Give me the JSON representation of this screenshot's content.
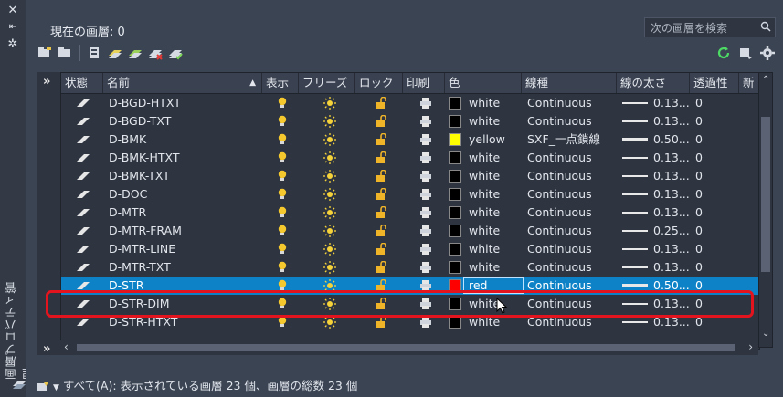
{
  "app": {
    "side_title": "画層プロパティ管理",
    "current_layer_label": "現在の画層: 0",
    "search_placeholder": "次の画層を検索",
    "status_text": "すべて(A): 表示されている画層 23 個、画層の総数 23 個"
  },
  "columns": [
    "状態",
    "名前",
    "表示",
    "フリーズ",
    "ロック",
    "印刷",
    "色",
    "線種",
    "線の太さ",
    "透過性",
    "新"
  ],
  "rows": [
    {
      "name": "D-BGD-HTXT",
      "color": "white",
      "color_hex": "#000000",
      "linetype": "Continuous",
      "lineweight": "0.13...",
      "transparency": "0",
      "thick": false
    },
    {
      "name": "D-BGD-TXT",
      "color": "white",
      "color_hex": "#000000",
      "linetype": "Continuous",
      "lineweight": "0.13...",
      "transparency": "0",
      "thick": false
    },
    {
      "name": "D-BMK",
      "color": "yellow",
      "color_hex": "#ffff00",
      "linetype": "SXF_一点鎖線",
      "lineweight": "0.50...",
      "transparency": "0",
      "thick": true
    },
    {
      "name": "D-BMK-HTXT",
      "color": "white",
      "color_hex": "#000000",
      "linetype": "Continuous",
      "lineweight": "0.13...",
      "transparency": "0",
      "thick": false
    },
    {
      "name": "D-BMK-TXT",
      "color": "white",
      "color_hex": "#000000",
      "linetype": "Continuous",
      "lineweight": "0.13...",
      "transparency": "0",
      "thick": false
    },
    {
      "name": "D-DOC",
      "color": "white",
      "color_hex": "#000000",
      "linetype": "Continuous",
      "lineweight": "0.13...",
      "transparency": "0",
      "thick": false
    },
    {
      "name": "D-MTR",
      "color": "white",
      "color_hex": "#000000",
      "linetype": "Continuous",
      "lineweight": "0.13...",
      "transparency": "0",
      "thick": false
    },
    {
      "name": "D-MTR-FRAM",
      "color": "white",
      "color_hex": "#000000",
      "linetype": "Continuous",
      "lineweight": "0.25...",
      "transparency": "0",
      "thick": false
    },
    {
      "name": "D-MTR-LINE",
      "color": "white",
      "color_hex": "#000000",
      "linetype": "Continuous",
      "lineweight": "0.13...",
      "transparency": "0",
      "thick": false
    },
    {
      "name": "D-MTR-TXT",
      "color": "white",
      "color_hex": "#000000",
      "linetype": "Continuous",
      "lineweight": "0.13...",
      "transparency": "0",
      "thick": false
    },
    {
      "name": "D-STR",
      "color": "red",
      "color_hex": "#ff0000",
      "linetype": "Continuous",
      "lineweight": "0.50...",
      "transparency": "0",
      "thick": true,
      "selected": true
    },
    {
      "name": "D-STR-DIM",
      "color": "white",
      "color_hex": "#000000",
      "linetype": "Continuous",
      "lineweight": "0.13...",
      "transparency": "0",
      "thick": false
    },
    {
      "name": "D-STR-HTXT",
      "color": "white",
      "color_hex": "#000000",
      "linetype": "Continuous",
      "lineweight": "0.13...",
      "transparency": "0",
      "thick": false
    }
  ],
  "colors": {
    "accent": "#0e82c6",
    "highlight": "#e4141e",
    "bulb": "#f5c92e",
    "lock": "#f0b429"
  }
}
